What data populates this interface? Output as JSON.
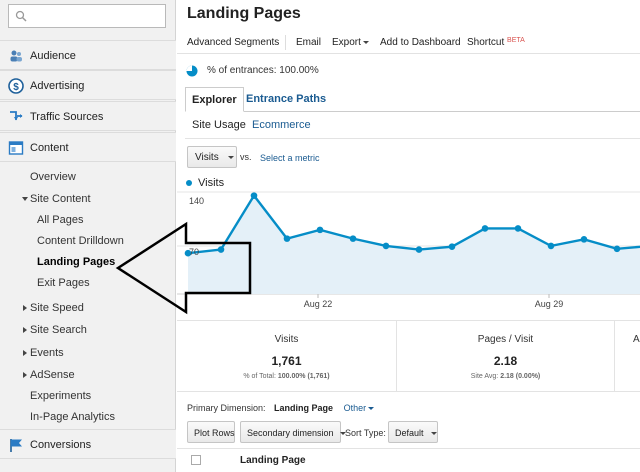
{
  "sidebar": {
    "search": {
      "placeholder": ""
    },
    "sections": [
      {
        "label": "Audience",
        "icon": "people-icon"
      },
      {
        "label": "Advertising",
        "icon": "dollar-icon"
      },
      {
        "label": "Traffic Sources",
        "icon": "traffic-arrow-icon"
      },
      {
        "label": "Content",
        "icon": "content-page-icon"
      }
    ],
    "content_items": {
      "overview": "Overview",
      "site_content": "Site Content",
      "all_pages": "All Pages",
      "content_drilldown": "Content Drilldown",
      "landing_pages": "Landing Pages",
      "exit_pages": "Exit Pages",
      "site_speed": "Site Speed",
      "site_search": "Site Search",
      "events": "Events",
      "adsense": "AdSense",
      "experiments": "Experiments",
      "in_page_analytics": "In-Page Analytics"
    },
    "conversions": "Conversions"
  },
  "header": {
    "title": "Landing Pages"
  },
  "toolbar": {
    "advanced_segments": "Advanced Segments",
    "email": "Email",
    "export": "Export",
    "add_to_dashboard": "Add to Dashboard",
    "shortcut": "Shortcut",
    "beta": "BETA"
  },
  "segment": {
    "text": "% of entrances: 100.00%"
  },
  "tabs": {
    "explorer": "Explorer",
    "entrance_paths": "Entrance Paths"
  },
  "subtabs": {
    "site_usage": "Site Usage",
    "ecommerce": "Ecommerce"
  },
  "metric": {
    "selected": "Visits",
    "vs": "vs.",
    "select_metric": "Select a metric"
  },
  "chart_data": {
    "type": "area",
    "series": [
      {
        "name": "Visits",
        "values": [
          56,
          61,
          135,
          76,
          88,
          76,
          66,
          61,
          65,
          90,
          90,
          66,
          75,
          62,
          66
        ]
      }
    ],
    "x_tick_labels": [
      "Aug 22",
      "Aug 29"
    ],
    "y_tick_labels": [
      "140",
      "70"
    ],
    "ylim": [
      0,
      140
    ],
    "color": "#058dc7"
  },
  "summary": [
    {
      "name": "Visits",
      "value": "1,761",
      "sub_label": "% of Total:",
      "sub_value": "100.00% (1,761)"
    },
    {
      "name": "Pages / Visit",
      "value": "2.18",
      "sub_label": "Site Avg:",
      "sub_value": "2.18 (0.00%)"
    },
    {
      "name": "A",
      "value": "",
      "sub_label": "",
      "sub_value": ""
    }
  ],
  "table": {
    "primary_dimension_label": "Primary Dimension:",
    "primary_dimension_value": "Landing Page",
    "other": "Other",
    "plot_rows": "Plot Rows",
    "secondary_dimension": "Secondary dimension",
    "sort_type_label": "Sort Type:",
    "sort_type_value": "Default",
    "column_header": "Landing Page"
  },
  "colors": {
    "accent": "#058dc7",
    "link": "#1a5b91",
    "sidebar_bg": "#f1f1f1"
  }
}
